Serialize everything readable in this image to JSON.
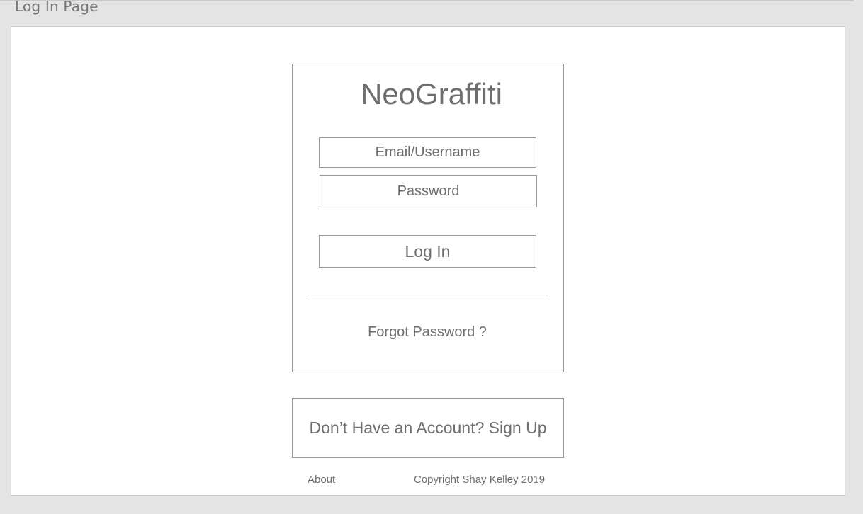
{
  "page": {
    "label": "Log In Page"
  },
  "login": {
    "brand": "NeoGraffiti",
    "email_placeholder": "Email/Username",
    "password_placeholder": "Password",
    "submit_label": "Log In",
    "forgot_link": "Forgot Password ?"
  },
  "signup": {
    "prompt": "Don’t Have an Account? Sign Up"
  },
  "footer": {
    "about": "About",
    "copyright": "Copyright Shay Kelley 2019"
  },
  "colors": {
    "background": "#e4e4e4",
    "canvas": "#ffffff",
    "border": "#9a9a9a",
    "text": "#6e6e6e"
  }
}
